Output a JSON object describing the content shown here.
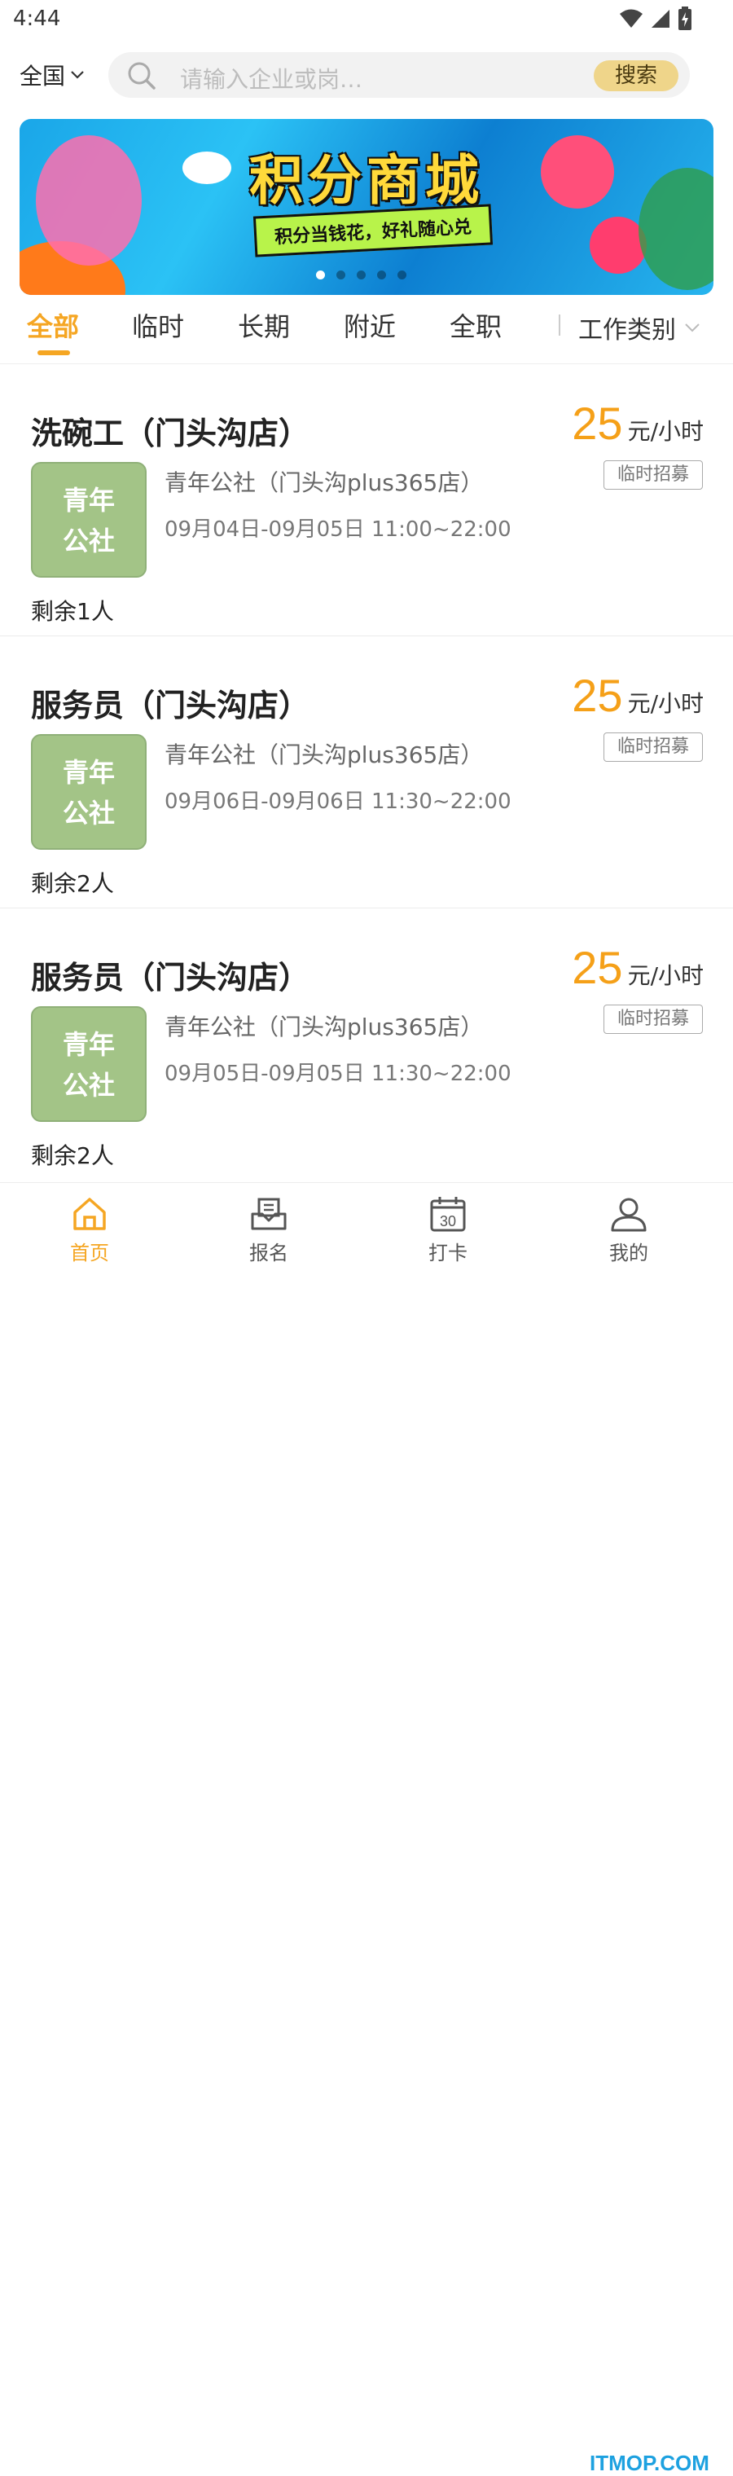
{
  "status_bar": {
    "time": "4:44"
  },
  "search": {
    "region": "全国",
    "placeholder": "请输入企业或岗…",
    "button_label": "搜索"
  },
  "banner": {
    "title": "积分商城",
    "subtitle": "积分当钱花，好礼随心兑",
    "carousel_count": 5,
    "active_index": 0
  },
  "tabs": {
    "items": [
      {
        "label": "全部",
        "active": true
      },
      {
        "label": "临时",
        "active": false
      },
      {
        "label": "长期",
        "active": false
      },
      {
        "label": "附近",
        "active": false
      },
      {
        "label": "全职",
        "active": false
      }
    ],
    "category_label": "工作类别"
  },
  "jobs": [
    {
      "title": "洗碗工（门头沟店）",
      "pay": "25",
      "unit": "元/小时",
      "logo_line1": "青年",
      "logo_line2": "公社",
      "company": "青年公社（门头沟plus365店）",
      "badge": "临时招募",
      "time_range": "09月04日-09月05日 11:00~22:00",
      "remaining": "剩余1人"
    },
    {
      "title": "服务员（门头沟店）",
      "pay": "25",
      "unit": "元/小时",
      "logo_line1": "青年",
      "logo_line2": "公社",
      "company": "青年公社（门头沟plus365店）",
      "badge": "临时招募",
      "time_range": "09月06日-09月06日 11:30~22:00",
      "remaining": "剩余2人"
    },
    {
      "title": "服务员（门头沟店）",
      "pay": "25",
      "unit": "元/小时",
      "logo_line1": "青年",
      "logo_line2": "公社",
      "company": "青年公社（门头沟plus365店）",
      "badge": "临时招募",
      "time_range": "09月05日-09月05日 11:30~22:00",
      "remaining": "剩余2人"
    }
  ],
  "bottom_nav": {
    "items": [
      {
        "label": "首页",
        "icon": "home-icon",
        "active": true
      },
      {
        "label": "报名",
        "icon": "inbox-icon",
        "active": false
      },
      {
        "label": "打卡",
        "icon": "calendar-icon",
        "active": false,
        "calendar_day": "30"
      },
      {
        "label": "我的",
        "icon": "user-icon",
        "active": false
      }
    ]
  },
  "watermark": "ITMOP.COM",
  "colors": {
    "accent": "#f5a623",
    "pay": "#f5a018",
    "logo_bg": "#a3c487",
    "search_button": "#efd58a"
  }
}
